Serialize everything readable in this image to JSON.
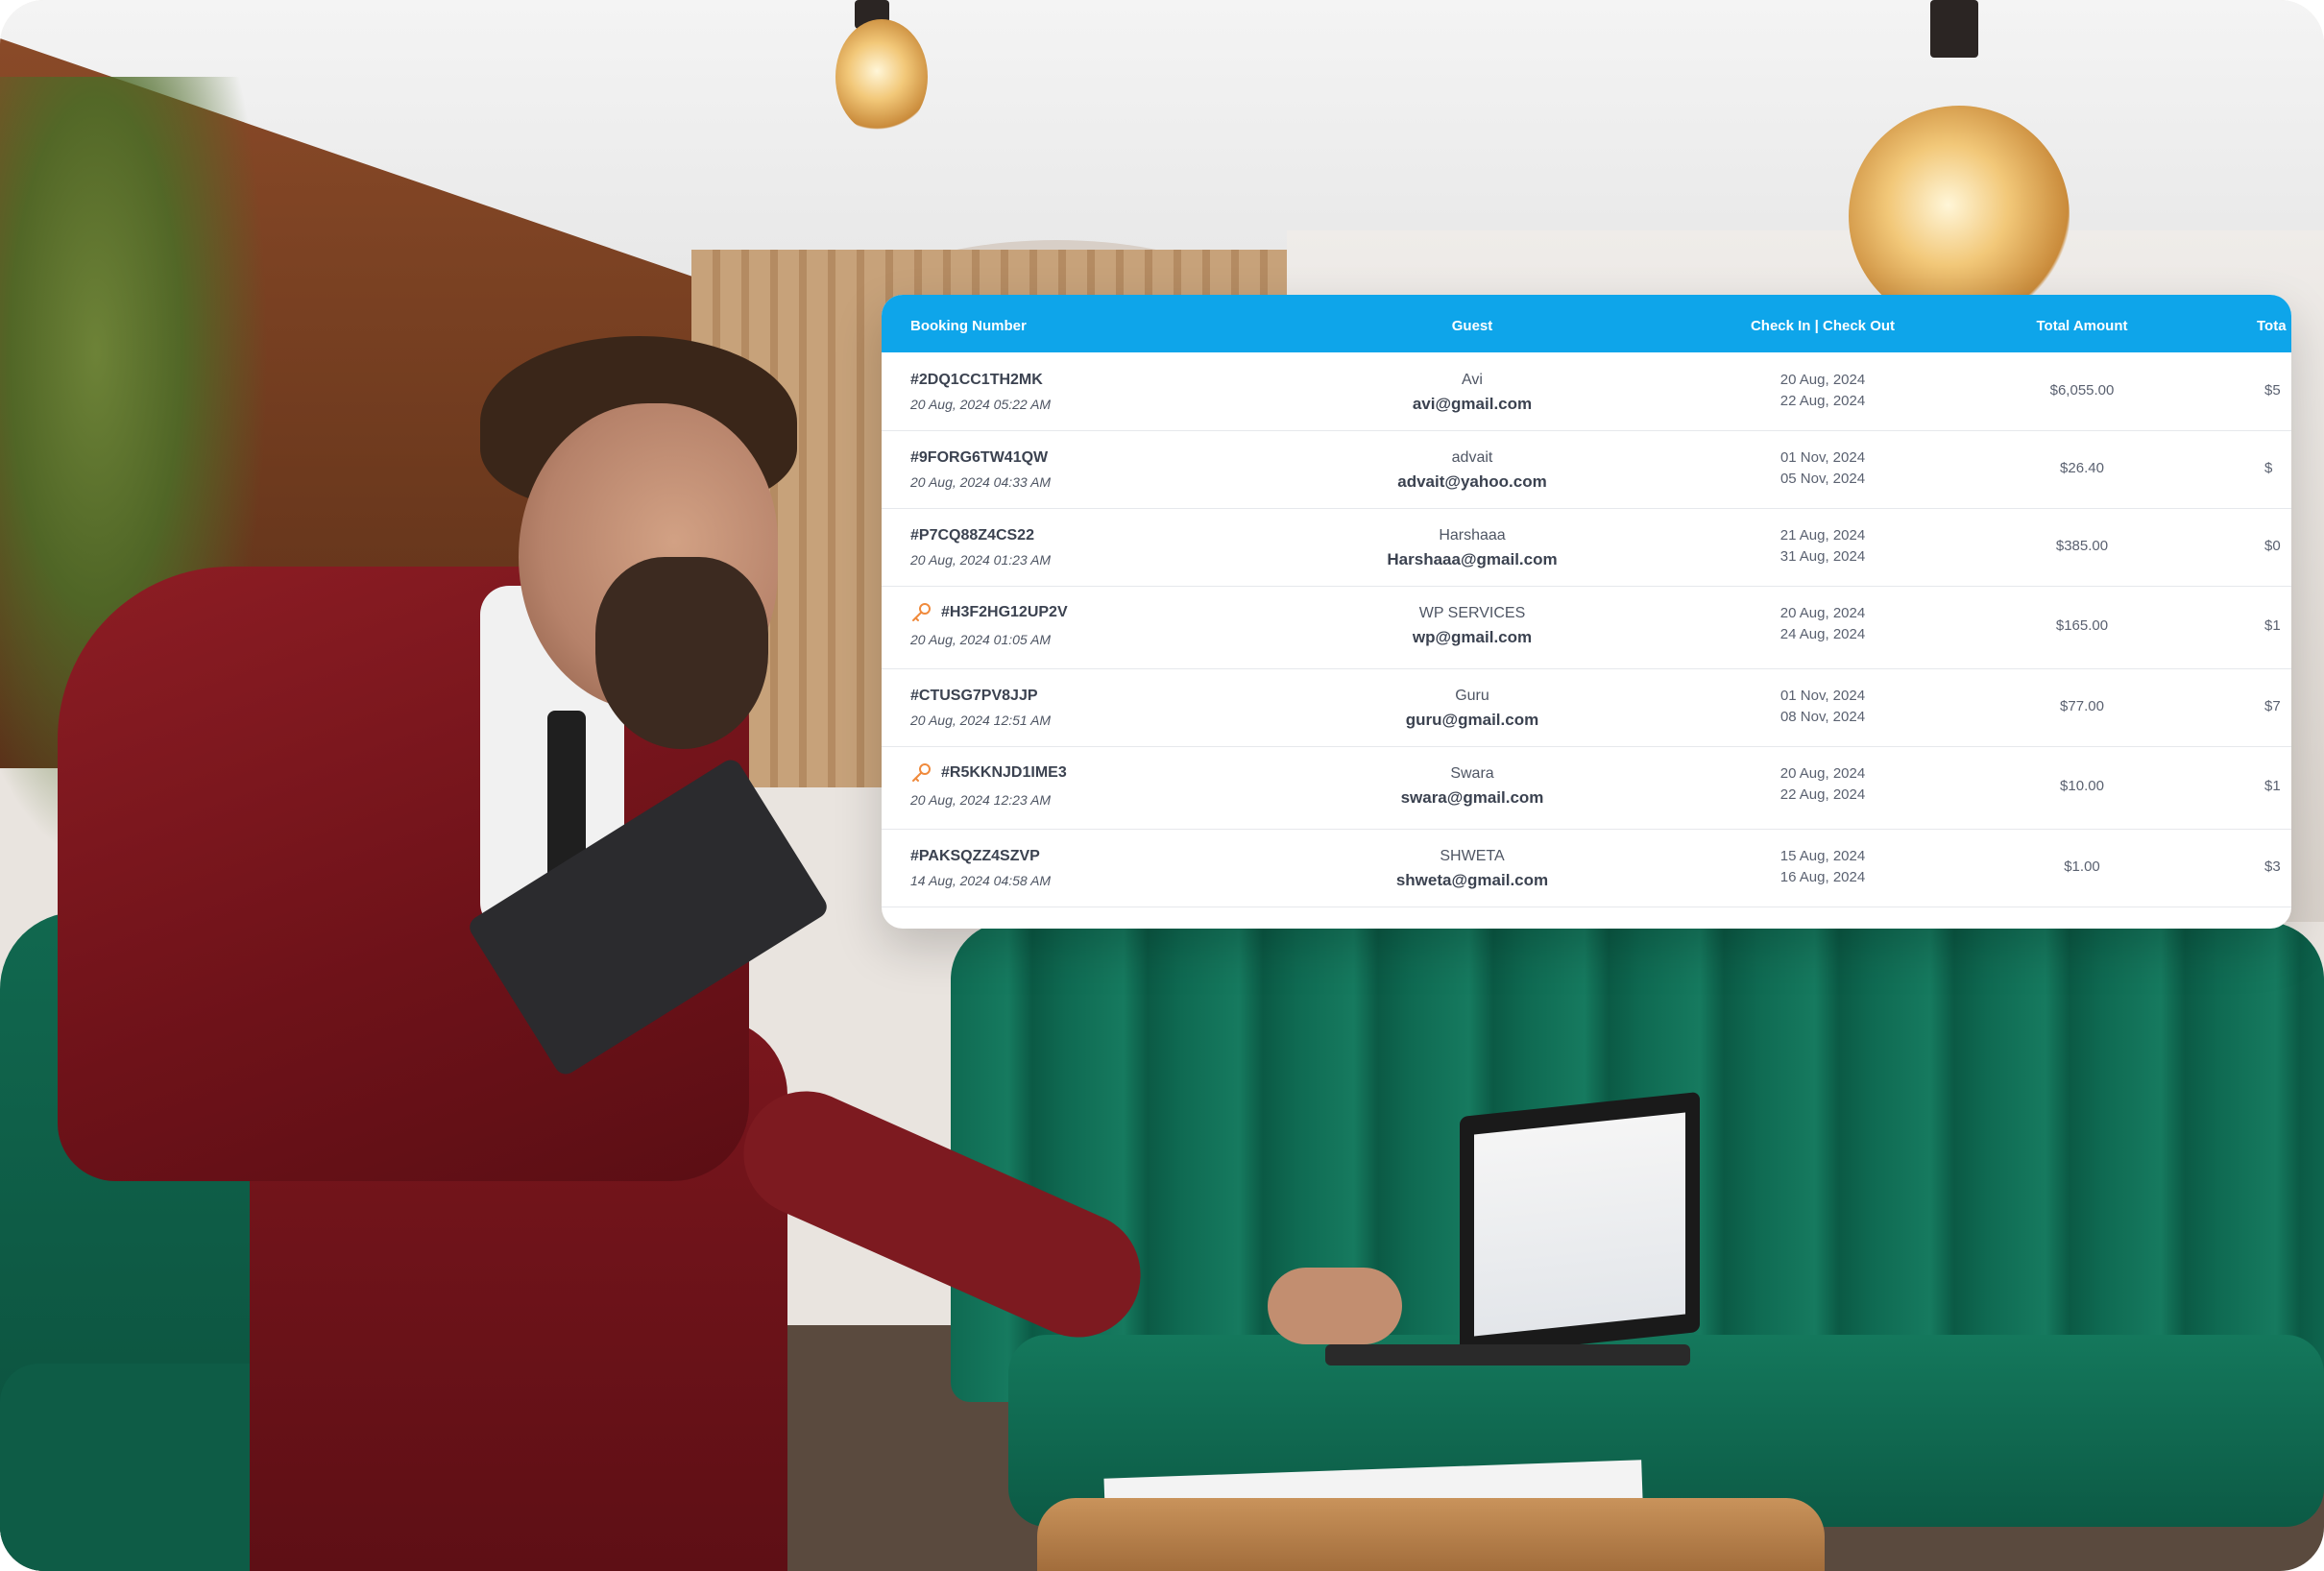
{
  "table": {
    "headers": {
      "booking_number": "Booking Number",
      "guest": "Guest",
      "check_in_out": "Check In | Check Out",
      "total_amount": "Total Amount",
      "total_cut": "Tota"
    },
    "rows": [
      {
        "booking_id": "#2DQ1CC1TH2MK",
        "created": "20 Aug, 2024 05:22 AM",
        "guest_name": "Avi",
        "guest_email": "avi@gmail.com",
        "check_in": "20 Aug, 2024",
        "check_out": "22 Aug, 2024",
        "total_amount": "$6,055.00",
        "next_col": "$5",
        "key_icon": false
      },
      {
        "booking_id": "#9FORG6TW41QW",
        "created": "20 Aug, 2024 04:33 AM",
        "guest_name": "advait",
        "guest_email": "advait@yahoo.com",
        "check_in": "01 Nov, 2024",
        "check_out": "05 Nov, 2024",
        "total_amount": "$26.40",
        "next_col": "$",
        "key_icon": false
      },
      {
        "booking_id": "#P7CQ88Z4CS22",
        "created": "20 Aug, 2024 01:23 AM",
        "guest_name": "Harshaaa",
        "guest_email": "Harshaaa@gmail.com",
        "check_in": "21 Aug, 2024",
        "check_out": "31 Aug, 2024",
        "total_amount": "$385.00",
        "next_col": "$0",
        "key_icon": false
      },
      {
        "booking_id": "#H3F2HG12UP2V",
        "created": "20 Aug, 2024 01:05 AM",
        "guest_name": "WP SERVICES",
        "guest_email": "wp@gmail.com",
        "check_in": "20 Aug, 2024",
        "check_out": "24 Aug, 2024",
        "total_amount": "$165.00",
        "next_col": "$1",
        "key_icon": true
      },
      {
        "booking_id": "#CTUSG7PV8JJP",
        "created": "20 Aug, 2024 12:51 AM",
        "guest_name": "Guru",
        "guest_email": "guru@gmail.com",
        "check_in": "01 Nov, 2024",
        "check_out": "08 Nov, 2024",
        "total_amount": "$77.00",
        "next_col": "$7",
        "key_icon": false
      },
      {
        "booking_id": "#R5KKNJD1IME3",
        "created": "20 Aug, 2024 12:23 AM",
        "guest_name": "Swara",
        "guest_email": "swara@gmail.com",
        "check_in": "20 Aug, 2024",
        "check_out": "22 Aug, 2024",
        "total_amount": "$10.00",
        "next_col": "$1",
        "key_icon": true
      },
      {
        "booking_id": "#PAKSQZZ4SZVP",
        "created": "14 Aug, 2024 04:58 AM",
        "guest_name": "SHWETA",
        "guest_email": "shweta@gmail.com",
        "check_in": "15 Aug, 2024",
        "check_out": "16 Aug, 2024",
        "total_amount": "$1.00",
        "next_col": "$3",
        "key_icon": false
      }
    ]
  },
  "colors": {
    "header_bg": "#0ea5ea",
    "key_icon": "#f08a3c",
    "text_dark": "#3b4250",
    "text_muted": "#5a6170"
  },
  "icons": {
    "key": "key-icon"
  }
}
